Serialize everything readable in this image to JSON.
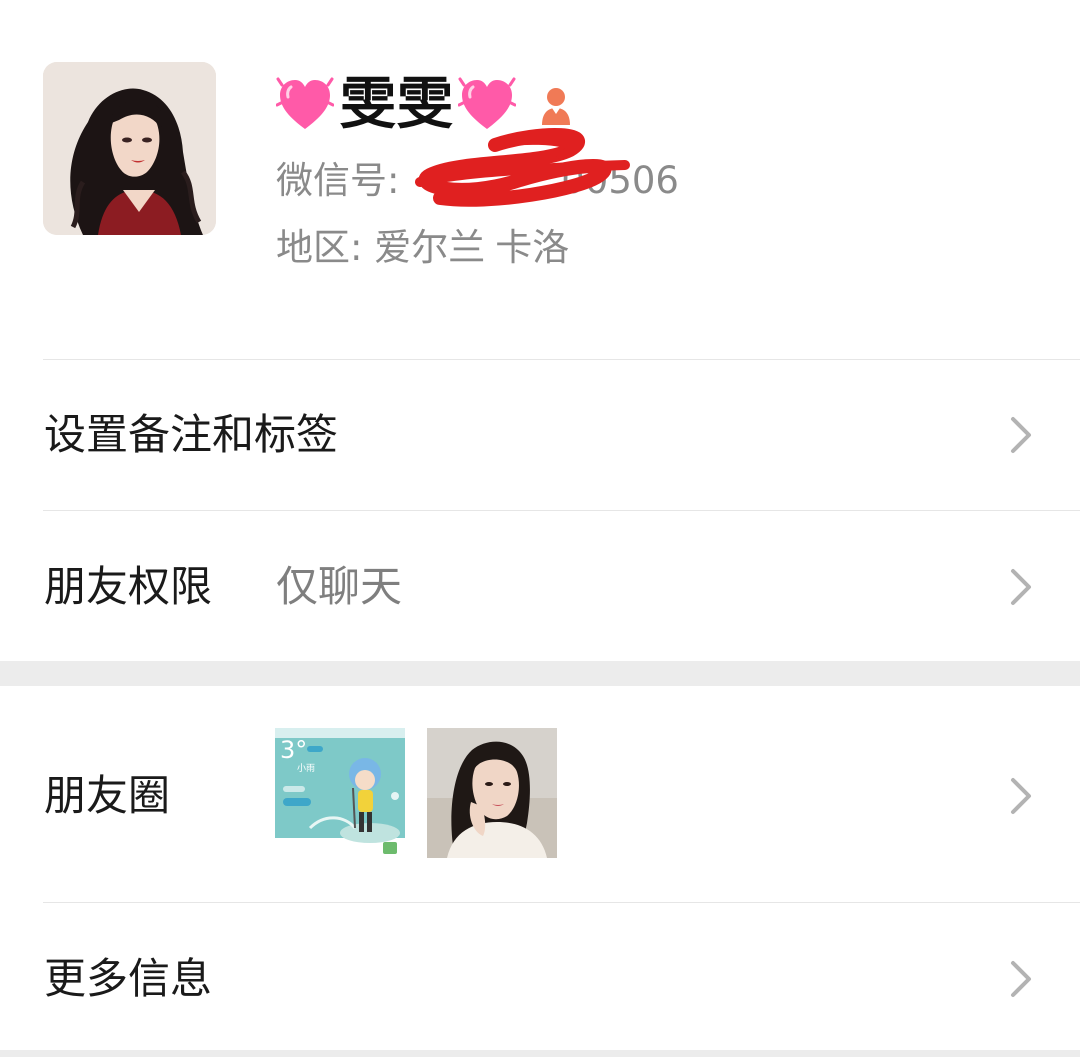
{
  "profile": {
    "display_name": "雯雯",
    "wechat_id_prefix": "微信号: ",
    "wechat_id_visible_suffix": "00506",
    "region_label": "地区: ",
    "region_country": "爱尔兰",
    "region_city": "卡洛",
    "avatar_icon": "avatar-illustration",
    "name_decoration_icon": "beating-heart-icon",
    "gender_icon": "female-icon"
  },
  "rows": {
    "remark_tags": {
      "label": "设置备注和标签"
    },
    "permissions": {
      "label": "朋友权限",
      "value": "仅聊天"
    },
    "moments": {
      "label": "朋友圈"
    },
    "more_info": {
      "label": "更多信息"
    }
  },
  "moments_thumbs": {
    "weather": {
      "temperature": "3°",
      "condition": "小雨"
    },
    "selfie": {}
  },
  "colors": {
    "text_primary": "#1a1a1a",
    "text_secondary": "#8a8a8a",
    "divider": "#e6e6e6",
    "section_gap": "#ececec",
    "chevron": "#b3b3b3",
    "heart": "#ff5aa8",
    "gender_icon": "#f07a56",
    "redaction_scribble": "#e02020"
  }
}
